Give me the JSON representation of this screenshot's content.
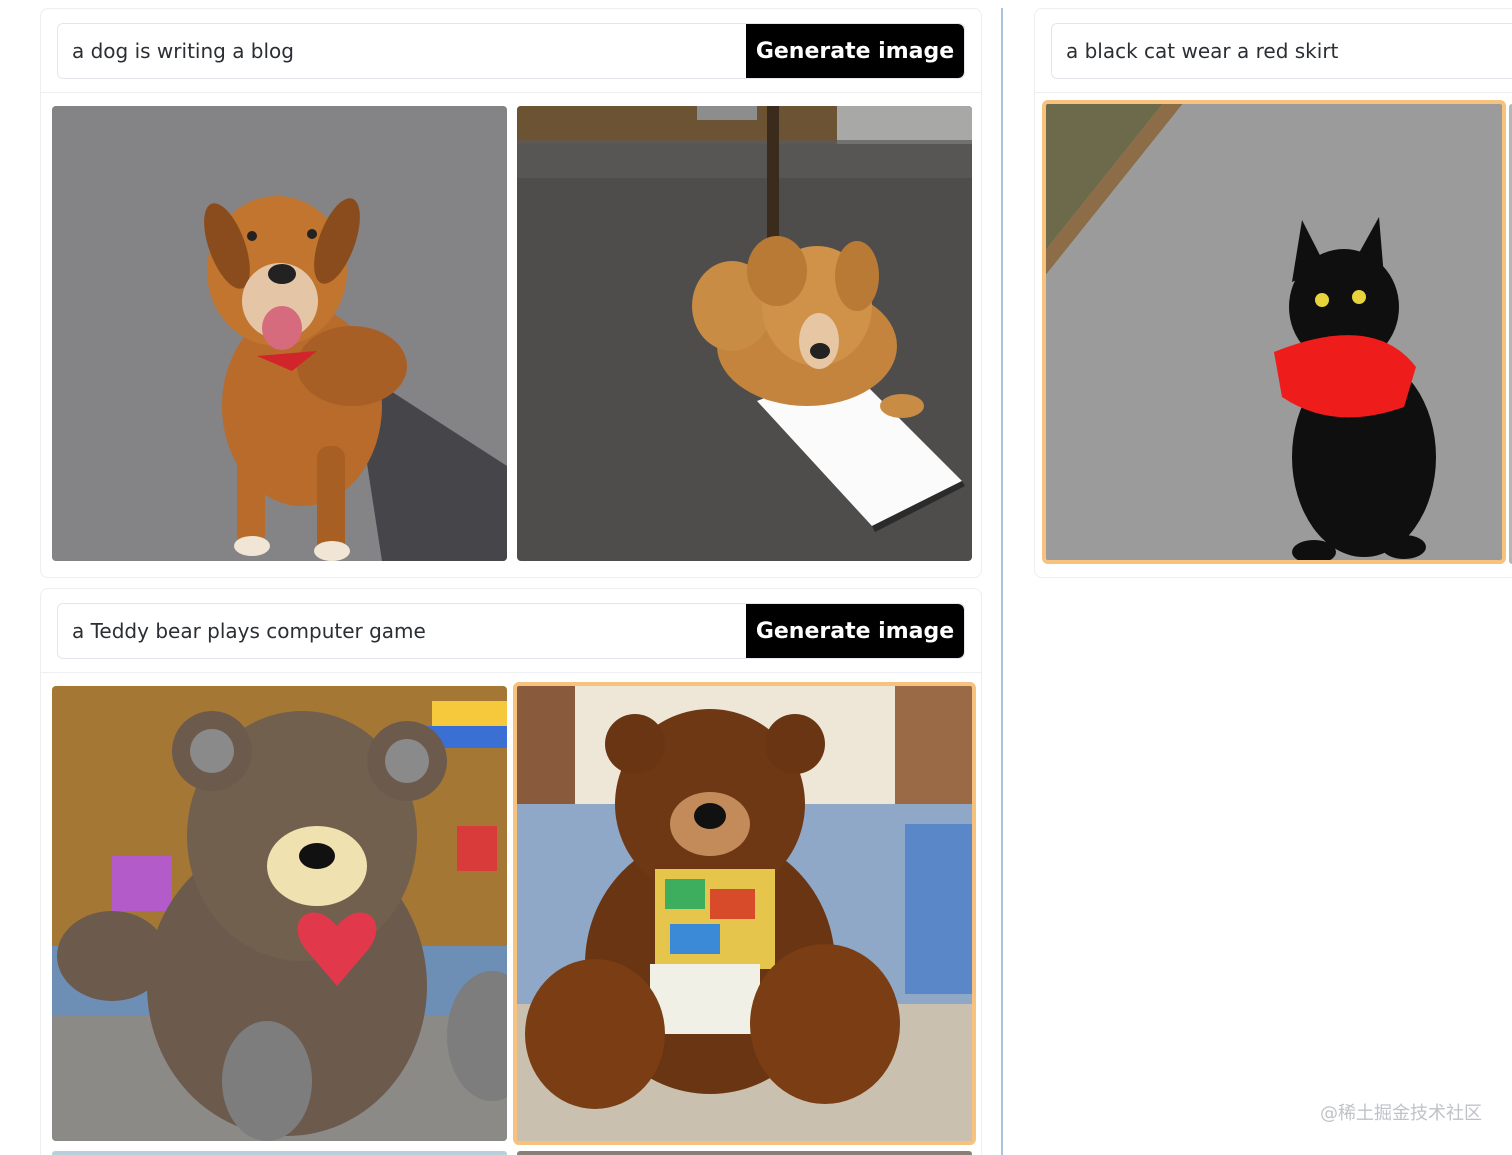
{
  "panels": [
    {
      "prompt_value": "a dog is writing a blog",
      "button_label": "Generate image",
      "images": [
        {
          "subject": "dog-sitting-on-asphalt",
          "selected": false
        },
        {
          "subject": "dog-lying-with-paper",
          "selected": false
        }
      ]
    },
    {
      "prompt_value": "a black cat wear a red skirt",
      "images": [
        {
          "subject": "black-cat-red-collar",
          "selected": true
        }
      ]
    },
    {
      "prompt_value": "a Teddy bear plays computer game",
      "button_label": "Generate image",
      "images": [
        {
          "subject": "teddy-bear-with-heart",
          "selected": false
        },
        {
          "subject": "teddy-bear-with-blocks",
          "selected": true
        }
      ]
    }
  ],
  "watermark": "@稀土掘金技术社区",
  "colors": {
    "selected_outline": "#f6c27e",
    "button_bg": "#000000",
    "divider": "#a9c2de"
  }
}
